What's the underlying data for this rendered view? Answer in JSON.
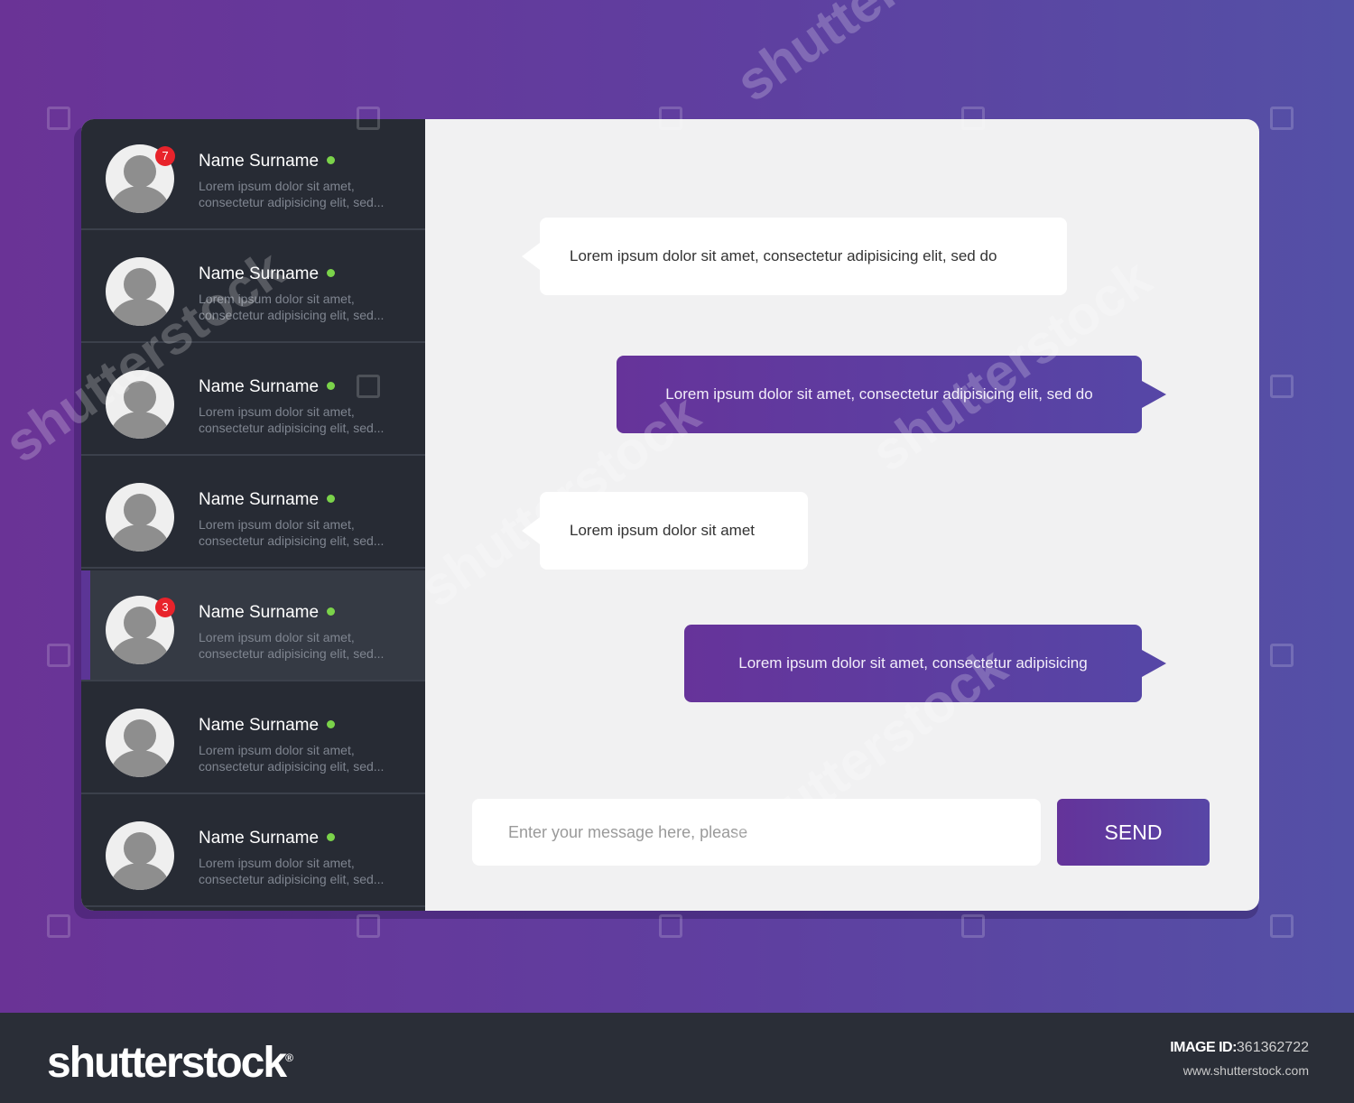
{
  "contacts": [
    {
      "name": "Name Surname",
      "preview": "Lorem ipsum dolor sit amet, consectetur adipisicing elit, sed...",
      "badge": "7",
      "online": true,
      "active": false
    },
    {
      "name": "Name Surname",
      "preview": "Lorem ipsum dolor sit amet, consectetur adipisicing elit, sed...",
      "badge": null,
      "online": true,
      "active": false
    },
    {
      "name": "Name Surname",
      "preview": "Lorem ipsum dolor sit amet, consectetur adipisicing elit, sed...",
      "badge": null,
      "online": true,
      "active": false
    },
    {
      "name": "Name Surname",
      "preview": "Lorem ipsum dolor sit amet, consectetur adipisicing elit, sed...",
      "badge": null,
      "online": true,
      "active": false
    },
    {
      "name": "Name Surname",
      "preview": "Lorem ipsum dolor sit amet, consectetur adipisicing elit, sed...",
      "badge": "3",
      "online": true,
      "active": true
    },
    {
      "name": "Name Surname",
      "preview": "Lorem ipsum dolor sit amet, consectetur adipisicing elit, sed...",
      "badge": null,
      "online": true,
      "active": false
    },
    {
      "name": "Name Surname",
      "preview": "Lorem ipsum dolor sit amet, consectetur adipisicing elit, sed...",
      "badge": null,
      "online": true,
      "active": false
    }
  ],
  "messages": [
    {
      "direction": "incoming",
      "text": "Lorem ipsum dolor sit amet, consectetur adipisicing elit, sed do"
    },
    {
      "direction": "outgoing",
      "text": "Lorem ipsum dolor sit amet, consectetur adipisicing elit, sed do"
    },
    {
      "direction": "incoming",
      "text": "Lorem ipsum dolor sit amet"
    },
    {
      "direction": "outgoing",
      "text": "Lorem ipsum dolor sit amet, consectetur adipisicing"
    }
  ],
  "composer": {
    "placeholder": "Enter your message here, please",
    "send_label": "SEND"
  },
  "footer": {
    "logo": "shutterstock",
    "logo_mark": "®",
    "image_id_label": "IMAGE ID:",
    "image_id_value": "361362722",
    "url": "www.shutterstock.com"
  },
  "watermark": "shutterstock",
  "colors": {
    "accent": "#5c3596",
    "sidebar": "#272b34",
    "online": "#7bd34a",
    "badge": "#e8232b"
  }
}
